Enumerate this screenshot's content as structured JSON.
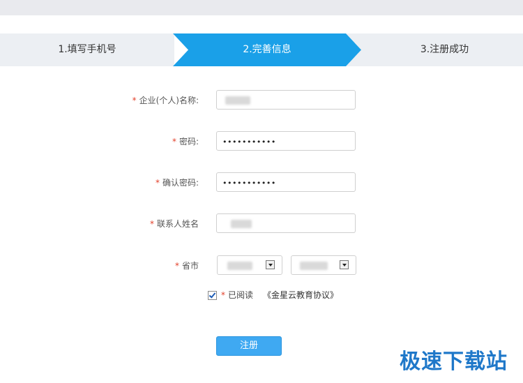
{
  "steps": [
    {
      "label": "1.填写手机号",
      "active": false
    },
    {
      "label": "2.完善信息",
      "active": true
    },
    {
      "label": "3.注册成功",
      "active": false
    }
  ],
  "colors": {
    "accent": "#1aa0e8",
    "required": "#e3412b",
    "step_inactive": "#eceff3",
    "button": "#3fa9f2"
  },
  "form": {
    "required_mark": "*",
    "company_name": {
      "label": "企业(个人)名称:",
      "value_obscured": true
    },
    "password": {
      "label": "密码:",
      "value": "•••••••••••"
    },
    "confirm_password": {
      "label": "确认密码:",
      "value": "•••••••••••"
    },
    "contact_name": {
      "label": "联系人姓名",
      "value_obscured": true
    },
    "province_city": {
      "label": "省市",
      "province_obscured": true,
      "city_obscured": true
    }
  },
  "agreement": {
    "checked": true,
    "text": "已阅读",
    "link": "《金星云教育协议》"
  },
  "submit": {
    "label": "注册"
  },
  "watermark": {
    "text": "极速下载站"
  }
}
